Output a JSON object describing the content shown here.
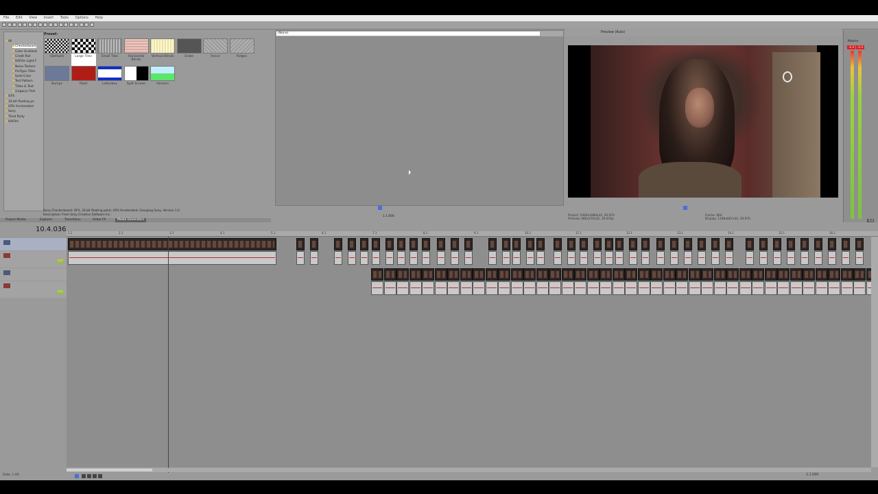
{
  "menu": [
    "File",
    "Edit",
    "View",
    "Insert",
    "Tools",
    "Options",
    "Help"
  ],
  "tree": {
    "items": [
      {
        "label": "All",
        "selected": false,
        "indent": 0
      },
      {
        "label": "Checkerboard",
        "selected": true,
        "indent": 1
      },
      {
        "label": "Color Gradient",
        "selected": false,
        "indent": 1
      },
      {
        "label": "Credit Roll",
        "selected": false,
        "indent": 1
      },
      {
        "label": "HitFilm Light F",
        "selected": false,
        "indent": 1
      },
      {
        "label": "Noise Texture",
        "selected": false,
        "indent": 1
      },
      {
        "label": "ProType Titler",
        "selected": false,
        "indent": 1
      },
      {
        "label": "Solid Color",
        "selected": false,
        "indent": 1
      },
      {
        "label": "Test Pattern",
        "selected": false,
        "indent": 1
      },
      {
        "label": "Titles & Text",
        "selected": false,
        "indent": 1
      },
      {
        "label": "(Legacy) Text",
        "selected": false,
        "indent": 1
      },
      {
        "label": "OFX",
        "selected": false,
        "indent": 0
      },
      {
        "label": "32-bit floating po",
        "selected": false,
        "indent": 0
      },
      {
        "label": "GPU Accelerated",
        "selected": false,
        "indent": 0
      },
      {
        "label": "Sony",
        "selected": false,
        "indent": 0
      },
      {
        "label": "Third Party",
        "selected": false,
        "indent": 0
      },
      {
        "label": "HitFilm",
        "selected": false,
        "indent": 0
      }
    ]
  },
  "presets": {
    "header": "Preset:",
    "items": [
      {
        "label": "(Default)",
        "style": "checker-small"
      },
      {
        "label": "Large Tiles",
        "style": "checker-large"
      },
      {
        "label": "Small Tiles",
        "style": "stripes-gray"
      },
      {
        "label": "Horizontal Blinds",
        "style": "pink"
      },
      {
        "label": "Vertical Blinds",
        "style": "cream"
      },
      {
        "label": "Grate",
        "style": "darkgray"
      },
      {
        "label": "Fence",
        "style": "diag"
      },
      {
        "label": "Ridges",
        "style": "diag2"
      },
      {
        "label": "Bumps",
        "style": "slate"
      },
      {
        "label": "Plaid",
        "style": "red"
      },
      {
        "label": "Letterbox",
        "style": "letterbox"
      },
      {
        "label": "Split Screen",
        "style": "split"
      },
      {
        "label": "Horizon",
        "style": "horizon"
      }
    ],
    "description_line1": "Sony Checkerboard: OFX, 32-bit floating point, GPU Accelerated, Grouping Sony, Version 1.0",
    "description_line2": "Description: From Sony Creative Software Inc."
  },
  "tabs": [
    "Project Media",
    "Explorer",
    "Transitions",
    "Video FX",
    "Media Generators"
  ],
  "active_tab": "Media Generators",
  "trimmer": {
    "selection": "(None)",
    "scale": "1.1.000"
  },
  "preview": {
    "mode": "Preview (Auto)",
    "project": "Project: 1920x1080x32, 29.970",
    "preview_line": "Preview: 480x270x32, 29.970p",
    "frame": "Frame: 464",
    "display": "Display: 1198x667x32, 29.970"
  },
  "master": {
    "label": "Master",
    "levels": [
      "-1.3",
      "-1.3"
    ],
    "values": [
      "-5.0",
      "-5.0"
    ]
  },
  "timeline": {
    "cursor_time": "10.4.036",
    "ruler_marks": [
      "1.1",
      "2.1",
      "3.1",
      "4.1",
      "5.1",
      "6.1",
      "7.1",
      "8.1",
      "9.1",
      "10.1",
      "11.1",
      "12.1",
      "13.1",
      "14.1",
      "15.1",
      "16.1"
    ],
    "rate": "Rate: 1.00",
    "bottom_time": "2.1.000"
  },
  "colors": {
    "app_bg": "#9a9a9a",
    "track_bg": "#8e8e8e",
    "video_clip": "#2e2624",
    "audio_wave": "#b82b2b"
  }
}
